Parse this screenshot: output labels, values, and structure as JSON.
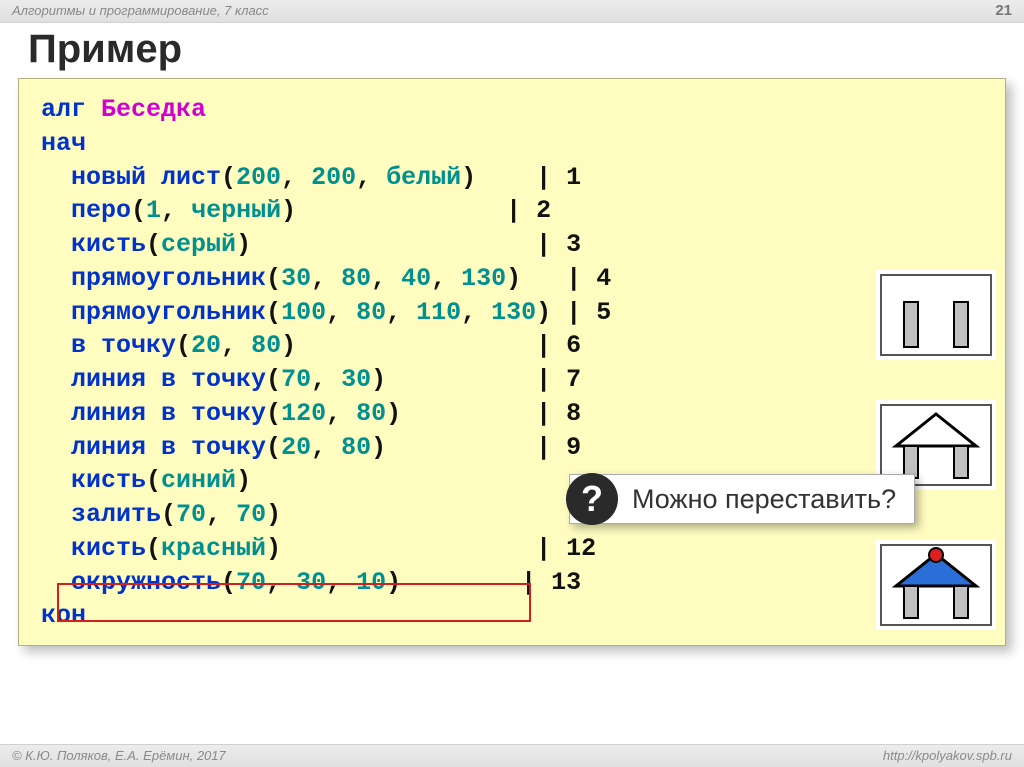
{
  "header": {
    "course": "Алгоритмы и программирование, 7 класс",
    "page": "21"
  },
  "title": "Пример",
  "code": {
    "l1_kw": "алг ",
    "l1_id": "Беседка",
    "l2_kw": "нач",
    "l3_kw": "  новый лист",
    "l3_p": "(",
    "l3_a": "200",
    "l3_c1": ", ",
    "l3_b": "200",
    "l3_c2": ", ",
    "l3_cc": "белый",
    "l3_q": ")",
    "l3_bar": "    | ",
    "l3_n": "1",
    "l4_kw": "  перо",
    "l4_p": "(",
    "l4_a": "1",
    "l4_c1": ", ",
    "l4_cc": "черный",
    "l4_q": ")",
    "l4_bar": "              | ",
    "l4_n": "2",
    "l5_kw": "  кисть",
    "l5_p": "(",
    "l5_cc": "серый",
    "l5_q": ")",
    "l5_bar": "                   | ",
    "l5_n": "3",
    "l6_kw": "  прямоугольник",
    "l6_p": "(",
    "l6_a": "30",
    "l6_c1": ", ",
    "l6_b": "80",
    "l6_c2": ", ",
    "l6_c": "40",
    "l6_c3": ", ",
    "l6_d": "130",
    "l6_q": ")",
    "l6_bar": "   | ",
    "l6_n": "4",
    "l7_kw": "  прямоугольник",
    "l7_p": "(",
    "l7_a": "100",
    "l7_c1": ", ",
    "l7_b": "80",
    "l7_c2": ", ",
    "l7_c": "110",
    "l7_c3": ", ",
    "l7_d": "130",
    "l7_q": ")",
    "l7_bar": " | ",
    "l7_n": "5",
    "l8_kw": "  в точку",
    "l8_p": "(",
    "l8_a": "20",
    "l8_c1": ", ",
    "l8_b": "80",
    "l8_q": ")",
    "l8_bar": "                | ",
    "l8_n": "6",
    "l9_kw": "  линия в точку",
    "l9_p": "(",
    "l9_a": "70",
    "l9_c1": ", ",
    "l9_b": "30",
    "l9_q": ")",
    "l9_bar": "          | ",
    "l9_n": "7",
    "l10_kw": "  линия в точку",
    "l10_p": "(",
    "l10_a": "120",
    "l10_c1": ", ",
    "l10_b": "80",
    "l10_q": ")",
    "l10_bar": "         | ",
    "l10_n": "8",
    "l11_kw": "  линия в точку",
    "l11_p": "(",
    "l11_a": "20",
    "l11_c1": ", ",
    "l11_b": "80",
    "l11_q": ")",
    "l11_bar": "          | ",
    "l11_n": "9",
    "l12_kw": "  кисть",
    "l12_p": "(",
    "l12_cc": "синий",
    "l12_q": ")",
    "l13_kw": "  залить",
    "l13_p": "(",
    "l13_a": "70",
    "l13_c1": ", ",
    "l13_b": "70",
    "l13_q": ")",
    "l14_kw": "  кисть",
    "l14_p": "(",
    "l14_cc": "красный",
    "l14_q": ")",
    "l14_bar": "                 | ",
    "l14_n": "12",
    "l15_kw": "  окружность",
    "l15_p": "(",
    "l15_a": "70",
    "l15_c1": ", ",
    "l15_b": "30",
    "l15_c2": ", ",
    "l15_c": "10",
    "l15_q": ")",
    "l15_bar": "        | ",
    "l15_n": "13",
    "l16_kw": "кон"
  },
  "question": "Можно переставить?",
  "footer": {
    "left": "© К.Ю. Поляков, Е.А. Ерёмин, 2017",
    "right": "http://kpolyakov.spb.ru"
  }
}
